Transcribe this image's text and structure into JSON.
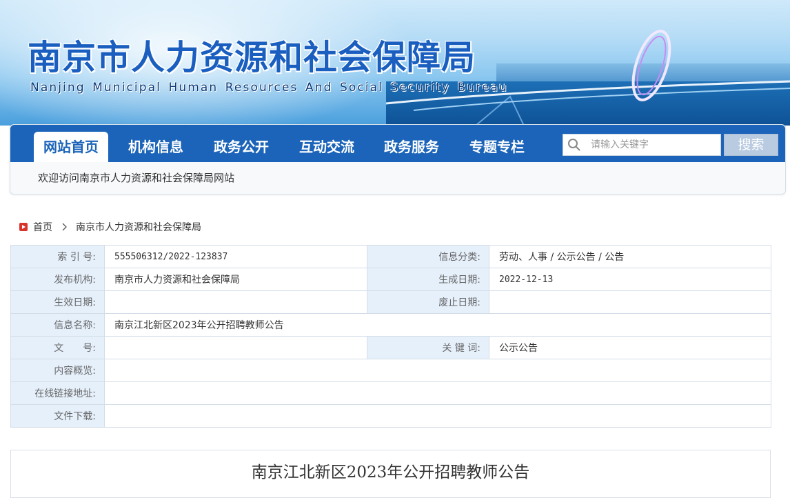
{
  "header": {
    "title": "南京市人力资源和社会保障局",
    "subtitle": "Nanjing Municipal Human Resources And Social Security Bureau"
  },
  "nav": {
    "items": [
      {
        "label": "网站首页",
        "active": true
      },
      {
        "label": "机构信息",
        "active": false
      },
      {
        "label": "政务公开",
        "active": false
      },
      {
        "label": "互动交流",
        "active": false
      },
      {
        "label": "政务服务",
        "active": false
      },
      {
        "label": "专题专栏",
        "active": false
      }
    ],
    "search_placeholder": "请输入关键字",
    "search_button": "搜索",
    "welcome": "欢迎访问南京市人力资源和社会保障局网站"
  },
  "breadcrumb": {
    "home": "首页",
    "current": "南京市人力资源和社会保障局"
  },
  "info": {
    "index_label": "索 引 号:",
    "index_value": "555506312/2022-123837",
    "category_label": "信息分类:",
    "category_value": "劳动、人事 / 公示公告 / 公告",
    "publisher_label": "发布机构:",
    "publisher_value": "南京市人力资源和社会保障局",
    "created_label": "生成日期:",
    "created_value": "2022-12-13",
    "effective_label": "生效日期:",
    "effective_value": "",
    "abolish_label": "废止日期:",
    "abolish_value": "",
    "name_label": "信息名称:",
    "name_value": "南京江北新区2023年公开招聘教师公告",
    "docno_label": "文　　号:",
    "docno_value": "",
    "keywords_label": "关 键 词:",
    "keywords_value": "公示公告",
    "summary_label": "内容概览:",
    "summary_value": "",
    "link_label": "在线链接地址:",
    "link_value": "",
    "download_label": "文件下载:",
    "download_value": ""
  },
  "article": {
    "title": "南京江北新区2023年公开招聘教师公告"
  },
  "colors": {
    "nav_blue": "#1b64b9",
    "label_bg": "#e6f0fb",
    "title_blue": "#1a5fc0",
    "home_icon_red": "#d9342b"
  },
  "icons": {
    "search": "search-icon",
    "home": "home-icon",
    "separator": "chevron-right-icon"
  }
}
